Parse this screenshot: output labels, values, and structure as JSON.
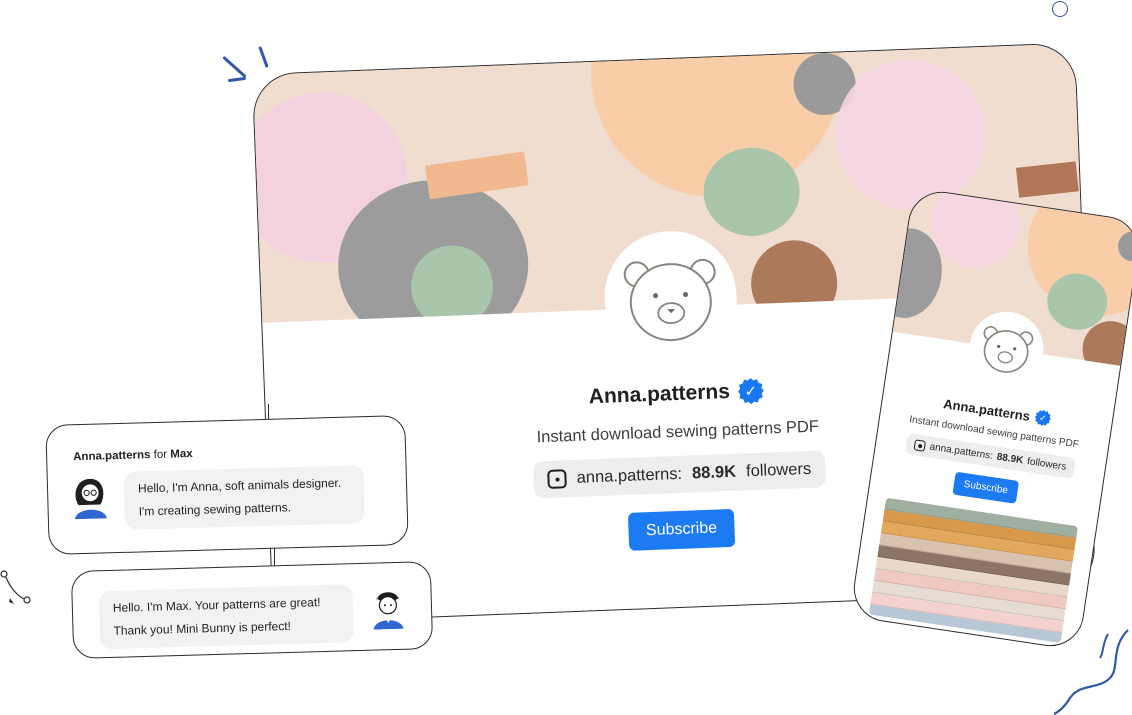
{
  "colors": {
    "accent": "#1c7bf2",
    "verified": "#1877f2"
  },
  "desktop": {
    "name": "Anna.patterns",
    "description": "Instant download sewing patterns PDF",
    "instagram_handle": "anna.patterns:",
    "followers_count": "88.9K",
    "followers_label": "followers",
    "subscribe_label": "Subscribe",
    "verified_icon": "check-badge-icon",
    "social_icon": "instagram-icon"
  },
  "mobile": {
    "name": "Anna.patterns",
    "description": "Instant download sewing patterns PDF",
    "instagram_handle": "anna.patterns:",
    "followers_count": "88.9K",
    "followers_label": "followers",
    "subscribe_label": "Subscribe"
  },
  "chat": {
    "header_sender": "Anna.patterns",
    "header_for": "for",
    "header_recipient": "Max",
    "incoming_lines": [
      "Hello, I'm Anna, soft animals designer.",
      "I'm creating sewing patterns."
    ],
    "outgoing_lines": [
      "Hello. I'm Max. Your patterns are great!",
      "Thank you! Mini Bunny is perfect!"
    ]
  }
}
